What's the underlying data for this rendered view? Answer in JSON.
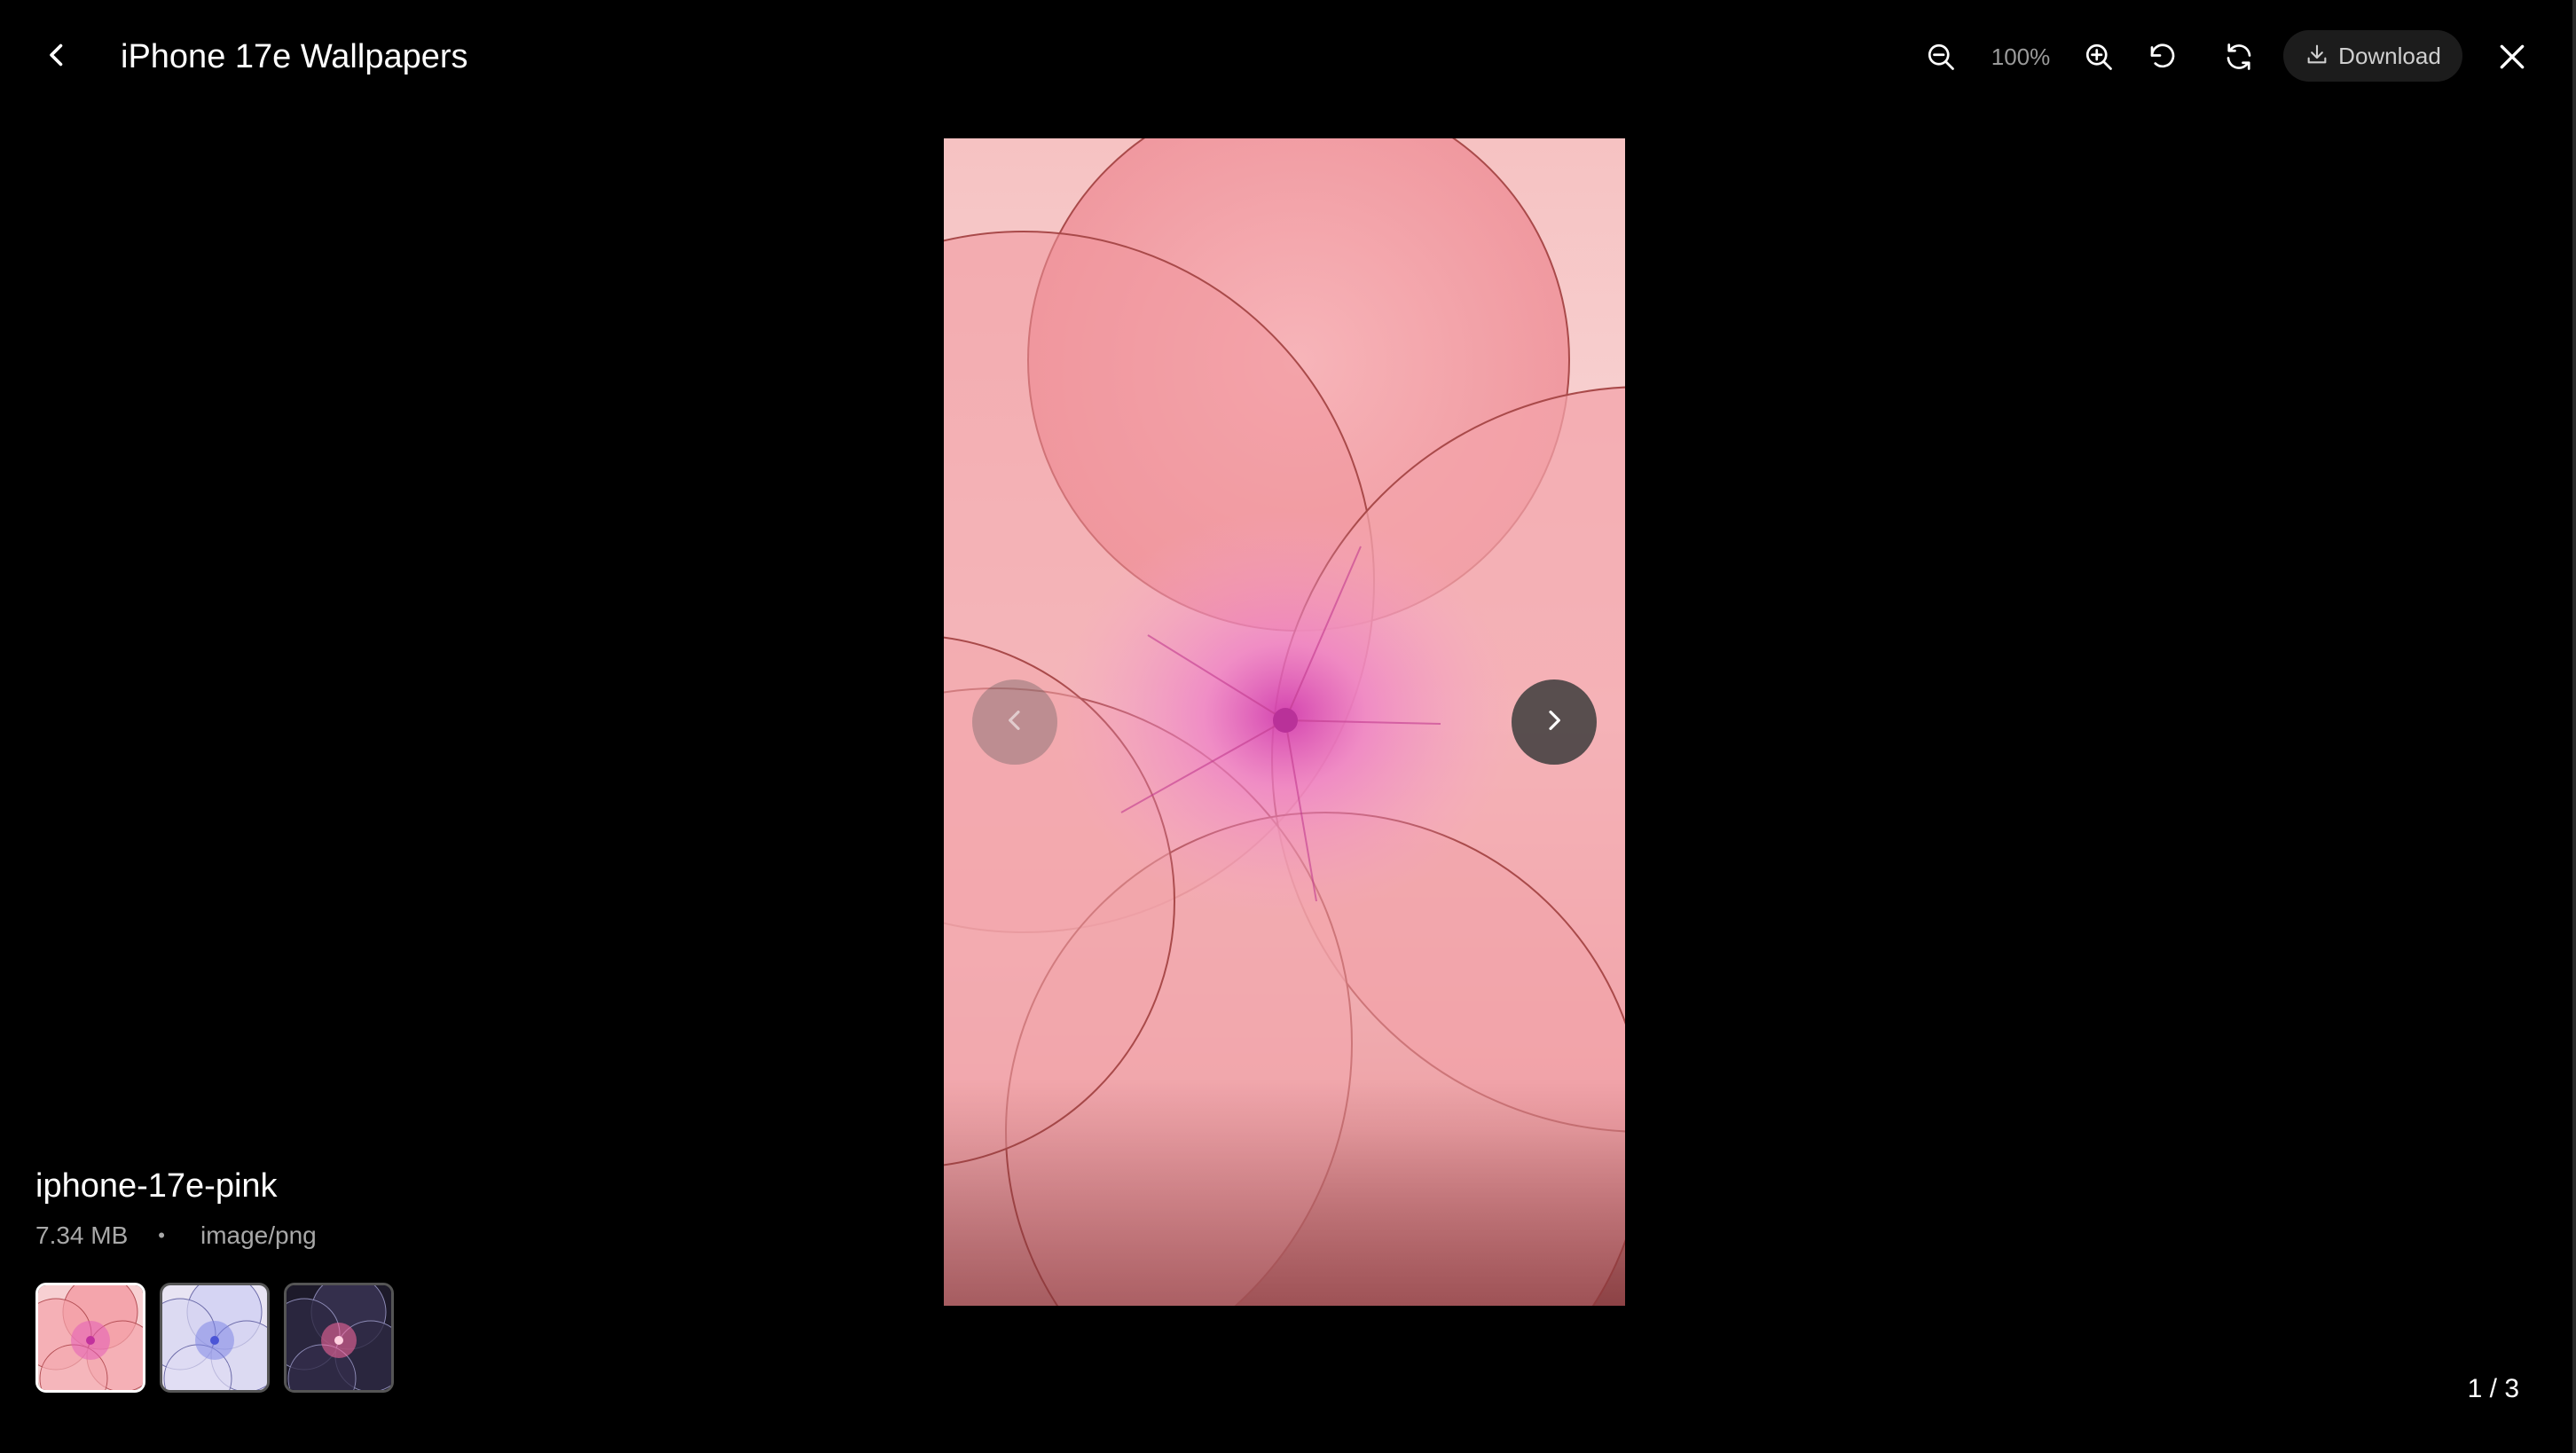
{
  "header": {
    "title": "iPhone 17e Wallpapers",
    "zoom_level": "100%",
    "download_label": "Download"
  },
  "icons": {
    "back": "chevron-left-icon",
    "zoom_out": "zoom-out-icon",
    "zoom_in": "zoom-in-icon",
    "rotate": "rotate-ccw-icon",
    "reset": "refresh-icon",
    "download": "download-icon",
    "close": "close-icon",
    "prev": "chevron-left-icon",
    "next": "chevron-right-icon"
  },
  "image": {
    "name": "iphone-17e-pink",
    "size": "7.34 MB",
    "separator": "•",
    "type": "image/png"
  },
  "thumbnails": [
    {
      "name": "thumbnail-pink",
      "accent": "#f08a9a"
    },
    {
      "name": "thumbnail-lavender",
      "accent": "#8c8fe8"
    },
    {
      "name": "thumbnail-dark",
      "accent": "#ff6aa0"
    }
  ],
  "pager": {
    "counter": "1 / 3"
  },
  "colors": {
    "background": "#000000",
    "petal": "#f4a6ad",
    "petal_outline": "#a94a4a",
    "center": "#d94fb4"
  }
}
